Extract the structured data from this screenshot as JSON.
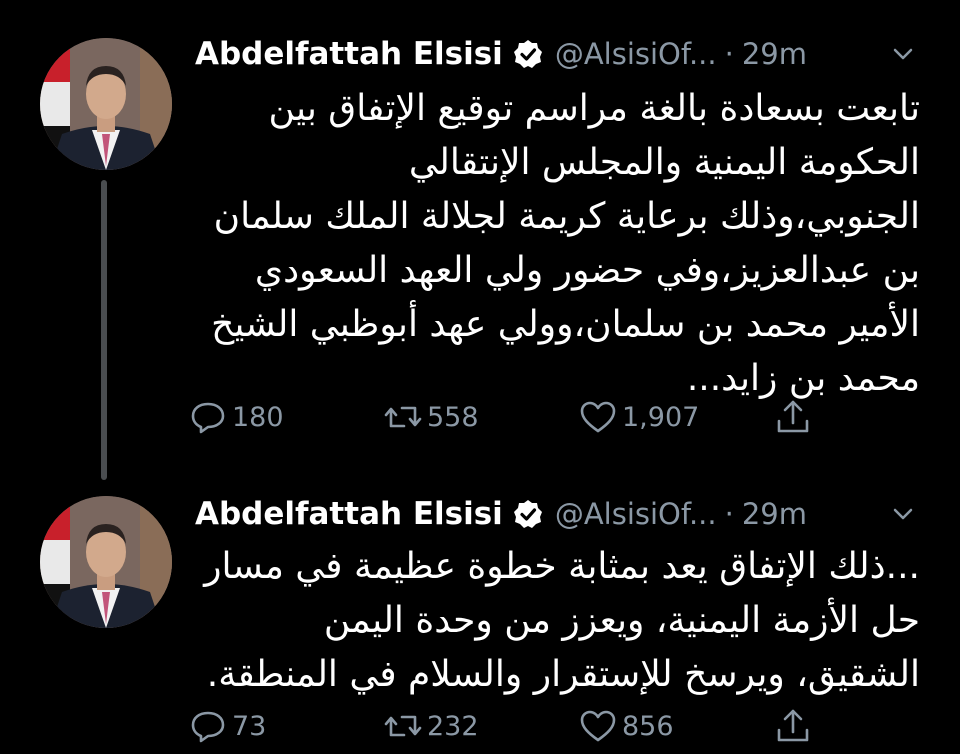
{
  "tweets": [
    {
      "name": "Abdelfattah Elsisi",
      "handle": "@AlsisiOf...",
      "separator": "·",
      "time": "29m",
      "lines": [
        "تابعت بسعادة بالغة مراسم توقيع الإتفاق بين",
        "الحكومة اليمنية والمجلس الإنتقالي",
        "الجنوبي،وذلك برعاية كريمة لجلالة الملك سلمان",
        "بن عبدالعزيز،وفي حضور ولي العهد السعودي",
        "الأمير محمد بن سلمان،وولي عهد أبوظبي الشيخ",
        "محمد بن زايد..."
      ],
      "replies": "180",
      "retweets": "558",
      "likes": "1,907"
    },
    {
      "name": "Abdelfattah Elsisi",
      "handle": "@AlsisiOf...",
      "separator": "·",
      "time": "29m",
      "lines": [
        "...ذلك الإتفاق يعد بمثابة خطوة عظيمة في مسار",
        "حل الأزمة اليمنية، ويعزز من وحدة اليمن",
        "الشقيق، ويرسخ للإستقرار والسلام في المنطقة."
      ],
      "replies": "73",
      "retweets": "232",
      "likes": "856"
    }
  ],
  "icons": {
    "verified": "verified-badge-icon",
    "chevron": "chevron-down-icon",
    "reply": "reply-icon",
    "retweet": "retweet-icon",
    "like": "heart-icon",
    "share": "share-icon"
  },
  "colors": {
    "background": "#000000",
    "text": "#ffffff",
    "secondary": "#8b98a5",
    "thread_line": "#4a4d50"
  }
}
